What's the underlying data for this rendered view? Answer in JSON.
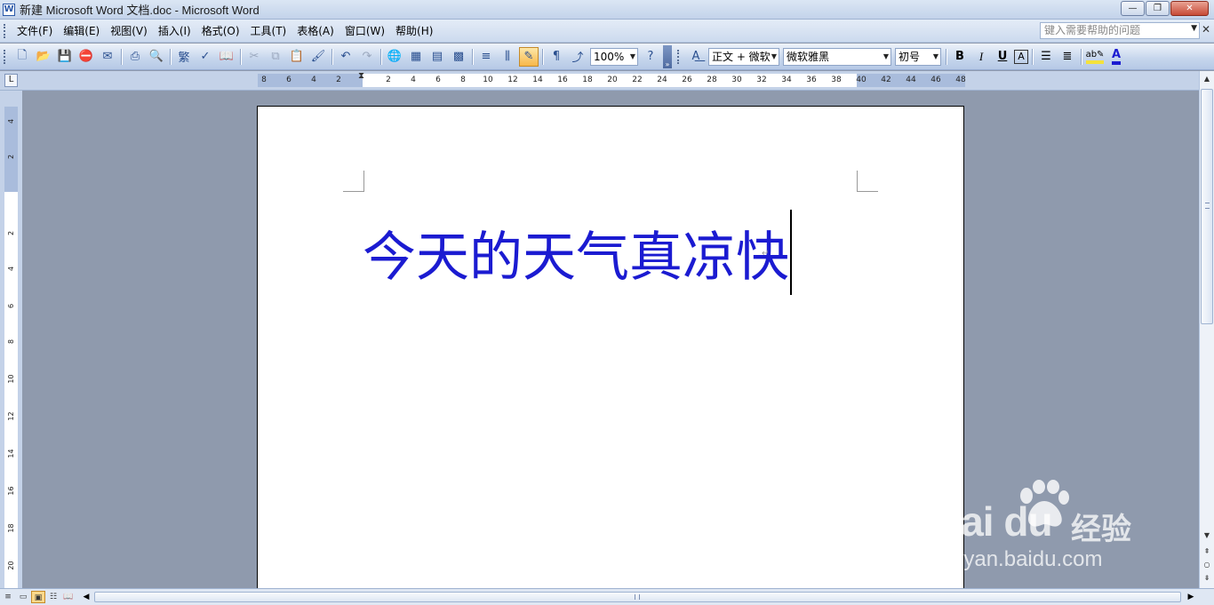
{
  "window": {
    "title": "新建 Microsoft Word 文档.doc - Microsoft Word",
    "app_icon": "W",
    "minimize_icon": "—",
    "restore_icon": "❐",
    "close_icon": "✕"
  },
  "menu": {
    "items": [
      "文件(F)",
      "编辑(E)",
      "视图(V)",
      "插入(I)",
      "格式(O)",
      "工具(T)",
      "表格(A)",
      "窗口(W)",
      "帮助(H)"
    ],
    "help_placeholder": "键入需要帮助的问题",
    "help_dropdown_icon": "▼",
    "close_doc_icon": "✕"
  },
  "toolbar": {
    "standard_icons": [
      "new-icon",
      "open-icon",
      "save-icon",
      "permission-icon",
      "print-icon",
      "print-preview-icon",
      "trad-chinese-icon",
      "spelling-icon",
      "research-icon",
      "cut-icon",
      "copy-icon",
      "paste-icon",
      "format-painter-icon",
      "undo-icon",
      "redo-icon",
      "hyperlink-icon",
      "tables-borders-icon",
      "insert-table-icon",
      "insert-excel-icon",
      "columns-icon",
      "drawing-icon",
      "doc-map-icon",
      "show-hide-icon",
      "reading-icon",
      "help-icon"
    ],
    "zoom": "100%",
    "style": "正文 + 微软",
    "font": "微软雅黑",
    "font_size": "初号",
    "bold": "B",
    "italic": "I",
    "underline": "U",
    "char_border": "A",
    "font_color_letter": "A",
    "highlight_color": "#f4e23b",
    "font_color": "#1b1bd1"
  },
  "ruler": {
    "tab_selector": "L",
    "h_ticks": [
      "8",
      "6",
      "4",
      "2",
      "2",
      "4",
      "6",
      "8",
      "10",
      "12",
      "14",
      "16",
      "18",
      "20",
      "22",
      "24",
      "26",
      "28",
      "30",
      "32",
      "34",
      "36",
      "38",
      "40",
      "42",
      "44",
      "46",
      "48"
    ],
    "v_ticks": [
      "4",
      "2",
      "2",
      "4",
      "6",
      "8",
      "10",
      "12",
      "14",
      "16",
      "18",
      "20"
    ]
  },
  "document": {
    "text": "今天的天气真凉快",
    "text_color": "#1b1bd1",
    "paragraph_mark": "↵"
  },
  "watermark": {
    "logo": "Bai  du",
    "brand_cn": "经验",
    "url": "jingyan.baidu.com"
  },
  "view_buttons": [
    "normal-view-icon",
    "web-layout-icon",
    "print-layout-icon",
    "outline-view-icon",
    "reading-layout-icon"
  ]
}
